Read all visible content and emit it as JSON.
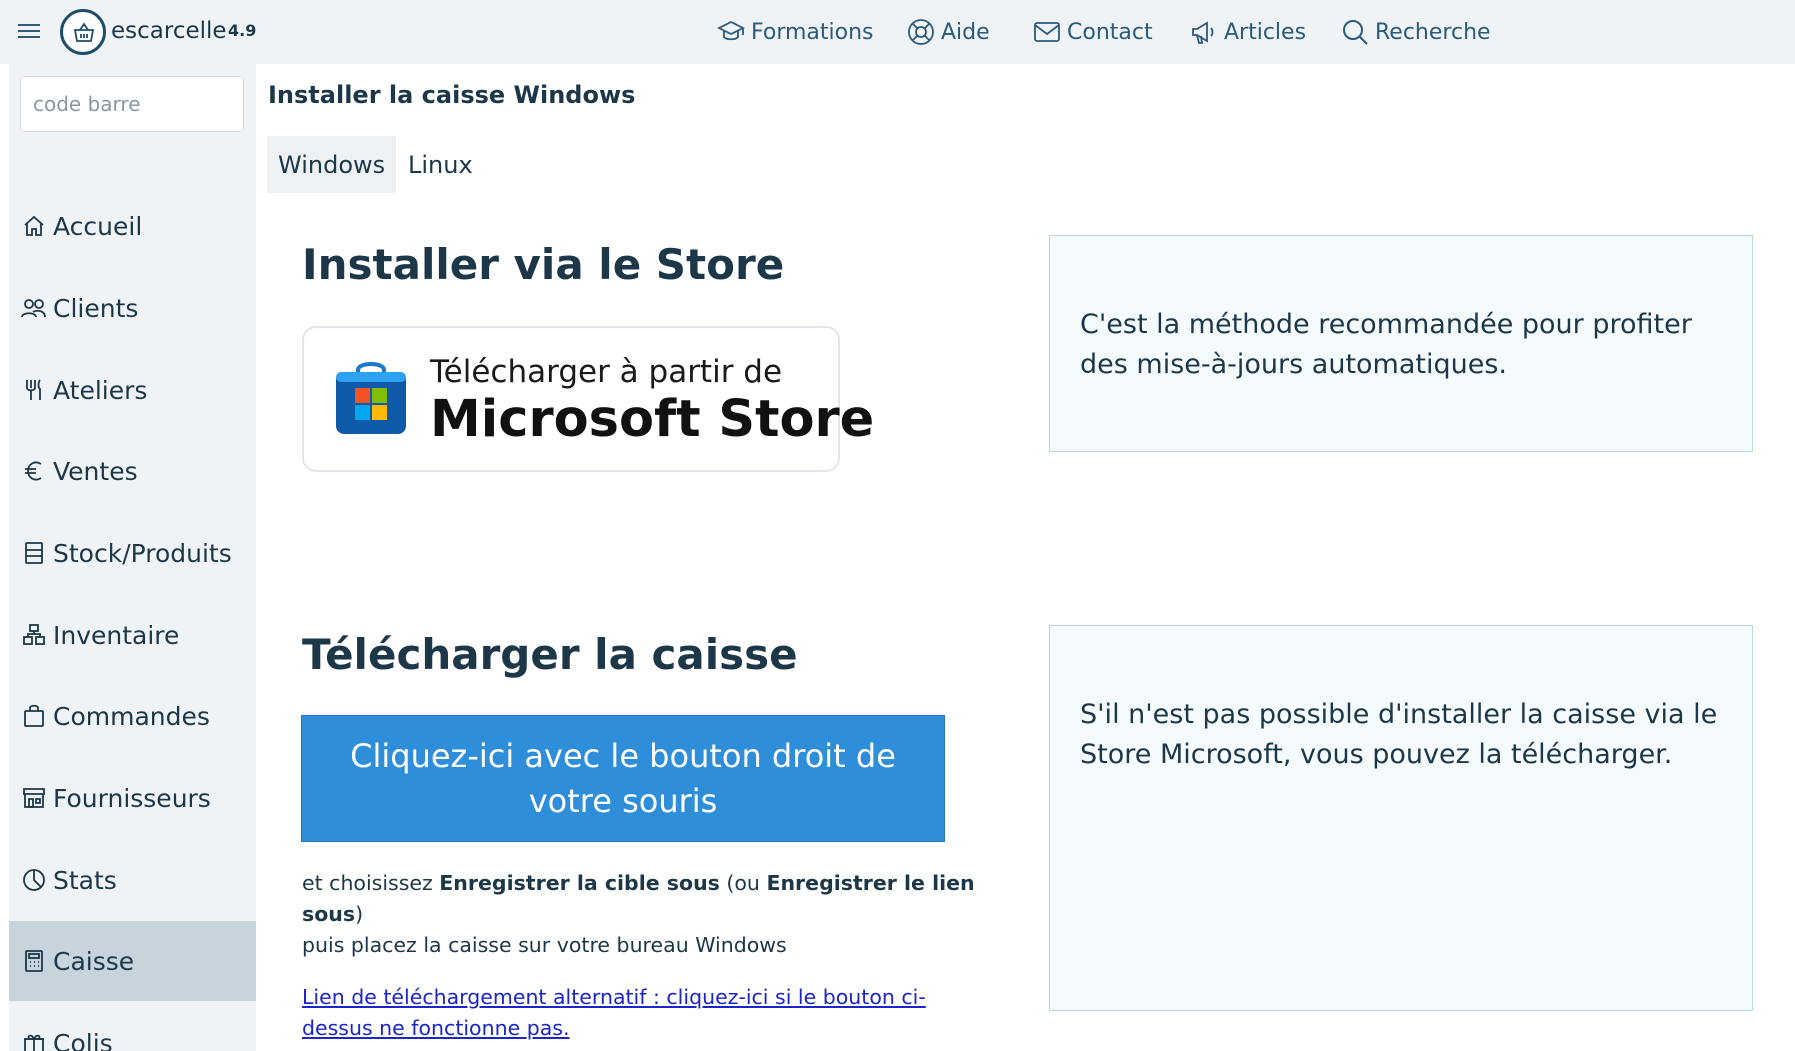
{
  "header": {
    "brand": "escarcelle",
    "version": "4.9",
    "nav": [
      {
        "label": "Formations",
        "icon": "graduation-cap-icon"
      },
      {
        "label": "Aide",
        "icon": "lifebuoy-icon"
      },
      {
        "label": "Contact",
        "icon": "envelope-icon"
      },
      {
        "label": "Articles",
        "icon": "megaphone-icon"
      },
      {
        "label": "Recherche",
        "icon": "search-icon"
      }
    ]
  },
  "sidebar": {
    "barcode_placeholder": "code barre",
    "items": [
      {
        "label": "Accueil",
        "icon": "home-icon"
      },
      {
        "label": "Clients",
        "icon": "people-icon"
      },
      {
        "label": "Ateliers",
        "icon": "utensils-icon"
      },
      {
        "label": "Ventes",
        "icon": "euro-icon"
      },
      {
        "label": "Stock/Produits",
        "icon": "stock-list-icon"
      },
      {
        "label": "Inventaire",
        "icon": "boxes-icon"
      },
      {
        "label": "Commandes",
        "icon": "shopping-bag-icon"
      },
      {
        "label": "Fournisseurs",
        "icon": "shop-icon"
      },
      {
        "label": "Stats",
        "icon": "pie-chart-icon"
      },
      {
        "label": "Caisse",
        "icon": "calculator-icon",
        "active": true
      },
      {
        "label": "Colis",
        "icon": "gift-icon"
      }
    ]
  },
  "main": {
    "title": "Installer la caisse Windows",
    "tabs": [
      {
        "label": "Windows",
        "active": true
      },
      {
        "label": "Linux",
        "active": false
      }
    ],
    "store_section": {
      "heading": "Installer via le Store",
      "button_line1": "Télécharger à partir de",
      "button_line2": "Microsoft Store",
      "info": "C'est la méthode recommandée pour profiter des mise-à-jours automatiques."
    },
    "download_section": {
      "heading": "Télécharger la caisse",
      "button_label": "Cliquez-ici avec le bouton droit de votre souris",
      "instr_1": "et choisissez ",
      "instr_bold_1": "Enregistrer la cible sous",
      "instr_2": " (ou ",
      "instr_bold_2": "Enregistrer le lien sous",
      "instr_3": ")",
      "instr_4": "puis placez la caisse sur votre bureau Windows",
      "alt_link": "Lien de téléchargement alternatif : cliquez-ici si le bouton ci-dessus ne fonctionne pas.",
      "info": "S'il n'est pas possible d'installer la caisse via le Store Microsoft, vous pouvez la télécharger."
    }
  },
  "colors": {
    "accent_blue": "#2f8ed9",
    "text_dark": "#1c3748",
    "nav_blue": "#2a5a7c",
    "sidebar_bg": "#f0f3f6",
    "active_bg": "#c8d4dc",
    "link": "#1b25c9"
  }
}
